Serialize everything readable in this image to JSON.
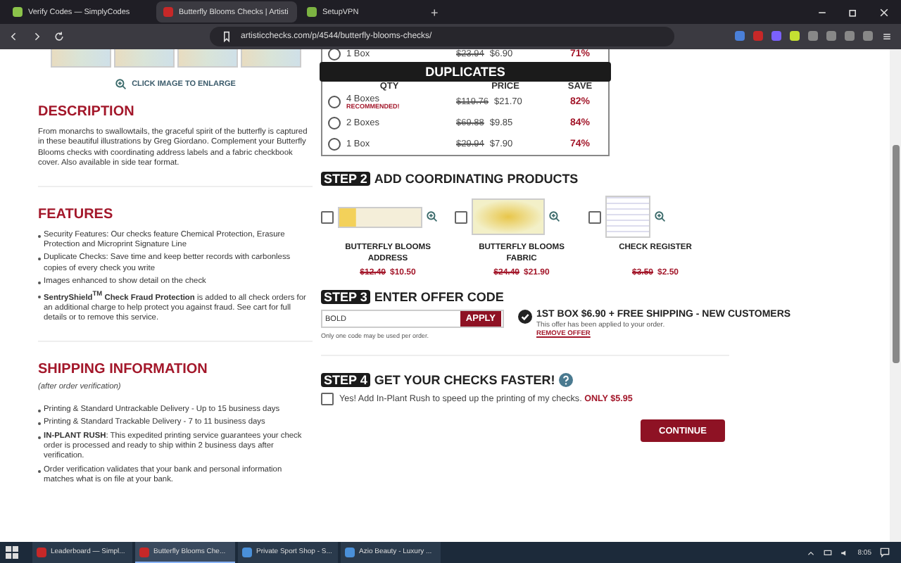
{
  "browser": {
    "tabs": [
      {
        "title": "Verify Codes — SimplyCodes",
        "selected": false
      },
      {
        "title": "Butterfly Blooms Checks | Artisti",
        "selected": true
      },
      {
        "title": "SetupVPN",
        "selected": false
      }
    ],
    "new_tab": "+",
    "url": "artisticchecks.com/p/4544/butterfly-blooms-checks/"
  },
  "gallery": {
    "enlarge_link": "CLICK IMAGE TO ENLARGE"
  },
  "description": {
    "title": "DESCRIPTION",
    "text": "From monarchs to swallowtails, the graceful spirit of the butterfly is captured in these beautiful illustrations by Greg Giordano. Complement your Butterfly Blooms checks with coordinating address labels and a fabric checkbook cover. Also available in side tear format."
  },
  "features": {
    "title": "FEATURES",
    "items": [
      "Security Features: Our checks feature Chemical Protection, Erasure Protection and Microprint Signature Line",
      "Duplicate Checks: Save time and keep better records with carbonless copies of every check you write",
      "Images enhanced to show detail on the check",
      "**SentryShield$^{TM}$ Check Fraud Protection** is added to all check orders for an additional charge to help protect you against fraud. See cart for full details or to remove this service."
    ]
  },
  "shipping": {
    "title": "SHIPPING INFORMATION",
    "subtitle": "(after order verification)",
    "items": [
      "Printing & Standard Untrackable Delivery - Up to 15 business days",
      "Printing & Standard Trackable Delivery - 7 to 11 business days",
      "**IN-PLANT RUSH**: This expedited printing service guarantees your check order is processed and ready to ship within 2 business days after verification.",
      "Order verification validates that your bank and personal information matches what is on file at your bank."
    ]
  },
  "singles_last_row": {
    "qty": "1 Box",
    "old_price": "$23.94",
    "price": "$6.90",
    "save": "71%",
    "selected": false
  },
  "duplicates": {
    "title": "DUPLICATES",
    "columns": [
      "QTY",
      "PRICE",
      "SAVE"
    ],
    "rows": [
      {
        "qty": "4 Boxes",
        "note": "RECOMMENDED!",
        "old_price": "$119.76",
        "price": "$21.70",
        "save": "82%",
        "selected": false
      },
      {
        "qty": "2 Boxes",
        "old_price": "$69.88",
        "price": "$9.85",
        "save": "84%",
        "selected": false
      },
      {
        "qty": "1 Box",
        "old_price": "$29.94",
        "price": "$7.90",
        "save": "74%",
        "selected": false
      }
    ]
  },
  "step2": {
    "badge": "STEP 2",
    "title": "ADD COORDINATING PRODUCTS",
    "products": [
      {
        "kind": "labels",
        "name": "BUTTERFLY BLOOMS ADDRESS",
        "old_price": "$12.40",
        "price": "$10.50",
        "checked": false
      },
      {
        "kind": "fabric",
        "name": "BUTTERFLY BLOOMS FABRIC",
        "old_price": "$24.40",
        "price": "$21.90",
        "checked": false
      },
      {
        "kind": "register",
        "name": "CHECK REGISTER",
        "old_price": "$3.50",
        "price": "$2.50",
        "checked": false
      }
    ]
  },
  "step3": {
    "badge": "STEP 3",
    "title": "ENTER OFFER CODE",
    "code": "BOLD",
    "apply": "APPLY",
    "note": "Only one code may be used per order.",
    "offer_title": "1ST BOX $6.90 + FREE SHIPPING - NEW CUSTOMERS",
    "offer_text": "This offer has been applied to your order.",
    "remove": "REMOVE OFFER",
    "applied": true
  },
  "step4": {
    "badge": "STEP 4",
    "title": "GET YOUR CHECKS FASTER!",
    "option": "Yes! Add In-Plant Rush to speed up the printing of my checks.",
    "option_price": "ONLY $5.95",
    "checked": false
  },
  "continue": "CONTINUE",
  "taskbar": {
    "apps": [
      {
        "title": "Leaderboard — Simpl...",
        "selected": false
      },
      {
        "title": "Butterfly Blooms Che...",
        "selected": true
      },
      {
        "title": "Private Sport Shop - S...",
        "selected": false
      },
      {
        "title": "Azio Beauty - Luxury ...",
        "selected": false
      }
    ],
    "time": "8:05"
  }
}
